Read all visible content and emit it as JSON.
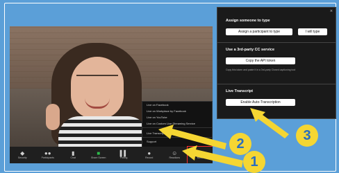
{
  "toolbar": {
    "buttons": [
      {
        "label": "Security",
        "icon": "shield-icon",
        "glyph": "◆"
      },
      {
        "label": "Participants",
        "icon": "participants-icon",
        "glyph": "●●"
      },
      {
        "label": "Chat",
        "icon": "chat-icon",
        "glyph": "▮"
      },
      {
        "label": "Share Screen",
        "icon": "share-screen-icon",
        "glyph": "■"
      },
      {
        "label": "Polling",
        "icon": "polling-icon",
        "glyph": "▌▌"
      },
      {
        "label": "Record",
        "icon": "record-icon",
        "glyph": "●"
      },
      {
        "label": "Reactions",
        "icon": "reactions-icon",
        "glyph": "☺"
      },
      {
        "label": "More",
        "icon": "more-icon",
        "glyph": "•••"
      }
    ]
  },
  "more_menu": {
    "items": [
      "Live on Facebook",
      "Live on Workplace by Facebook",
      "Live on YouTube",
      "Live on Custom Live Streaming Service"
    ],
    "live_transcript": "Live Transcript",
    "support": "Support"
  },
  "cc_panel": {
    "close_glyph": "×",
    "assign_title": "Assign someone to type",
    "assign_participant_button": "Assign a participant to type",
    "i_will_type_button": "I will type",
    "third_party_title": "Use a 3rd-party CC service",
    "copy_token_button": "Copy the API token",
    "token_description": "Copy this token and paste it in a 3rd-party Closed captioning tool",
    "live_transcript_title": "Live Transcript",
    "enable_auto_button": "Enable Auto-Transcription"
  },
  "annotations": {
    "badge_1": "1",
    "badge_2": "2",
    "badge_3": "3",
    "arrow_color": "#f5d633",
    "highlight_color": "#ff2d2d"
  }
}
